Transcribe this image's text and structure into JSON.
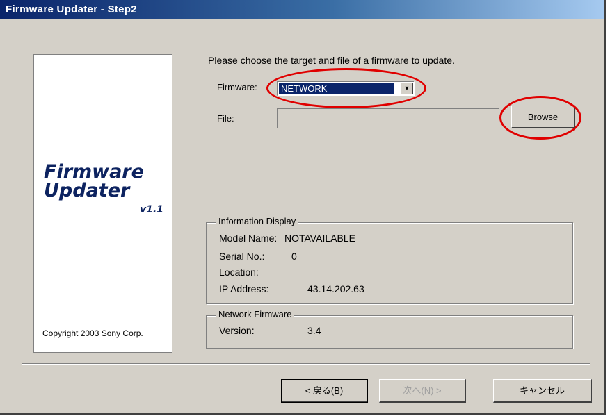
{
  "window": {
    "title": "Firmware Updater - Step2"
  },
  "logo": {
    "line1": "Firmware",
    "line2": "Updater",
    "version": "v1.1",
    "copyright": "Copyright 2003 Sony Corp."
  },
  "prompt": "Please choose the target and file of a firmware to update.",
  "firmware": {
    "label": "Firmware:",
    "value": "NETWORK"
  },
  "file": {
    "label": "File:",
    "value": ""
  },
  "buttons": {
    "browse": "Browse",
    "back": "< 戻る(B)",
    "next": "次へ(N) >",
    "cancel": "キャンセル"
  },
  "info_display": {
    "title": "Information Display",
    "model_name_label": "Model Name:",
    "model_name": "NOTAVAILABLE",
    "serial_label": "Serial No.:",
    "serial": "0",
    "location_label": "Location:",
    "location": "",
    "ip_label": "IP Address:",
    "ip": "43.14.202.63"
  },
  "network_firmware": {
    "title": "Network Firmware",
    "version_label": "Version:",
    "version": "3.4"
  },
  "annotation_color": "#e00000"
}
